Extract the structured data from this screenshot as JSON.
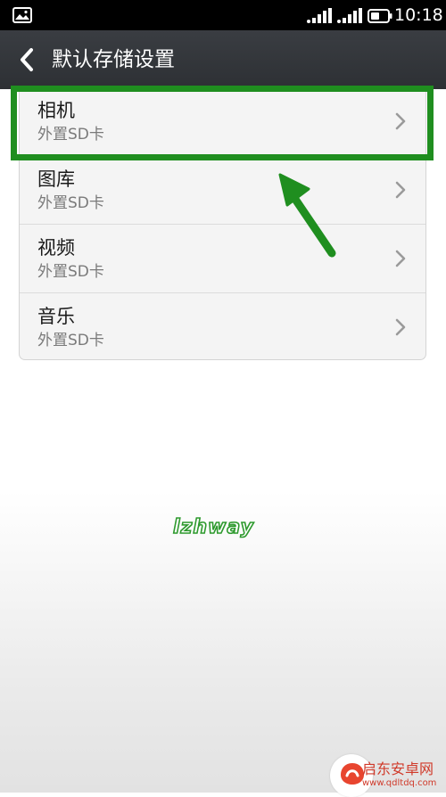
{
  "status_bar": {
    "time": "10:18",
    "icons": [
      "image-icon",
      "signal-icon",
      "signal-icon",
      "battery-icon"
    ]
  },
  "header": {
    "back_icon": "chevron-left-icon",
    "title": "默认存储设置"
  },
  "storage_list": {
    "items": [
      {
        "title": "相机",
        "value": "外置SD卡"
      },
      {
        "title": "图库",
        "value": "外置SD卡"
      },
      {
        "title": "视频",
        "value": "外置SD卡"
      },
      {
        "title": "音乐",
        "value": "外置SD卡"
      }
    ],
    "chevron_icon": "chevron-right-icon"
  },
  "annotation": {
    "highlight_color": "#1f8e1f",
    "arrow_icon": "arrow-up-left-icon",
    "watermark": "lzhway"
  },
  "footer_logo": {
    "name": "启东安卓网",
    "url": "www.qdltdq.com"
  },
  "colors": {
    "status_bar_bg": "#000000",
    "header_bg": "#2f3236",
    "list_bg": "#f4f4f4",
    "accent_green": "#1f8e1f"
  }
}
